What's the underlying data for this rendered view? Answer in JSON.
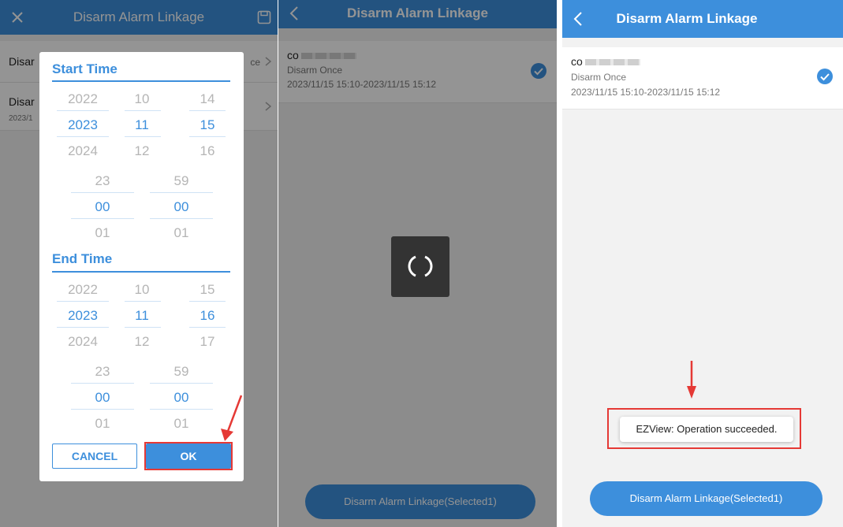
{
  "panel1": {
    "title": "Disarm Alarm Linkage",
    "rows": [
      {
        "t1": "Disar",
        "t1_right": "ce",
        "t2": ""
      },
      {
        "t1": "Disar",
        "t2": "2023/1"
      }
    ],
    "dialog": {
      "start_title": "Start Time",
      "end_title": "End Time",
      "start_date": {
        "years": [
          "2022",
          "2023",
          "2024"
        ],
        "months": [
          "10",
          "11",
          "12"
        ],
        "days": [
          "14",
          "15",
          "16"
        ]
      },
      "start_time": {
        "hours": [
          "23",
          "00",
          "01"
        ],
        "minutes": [
          "59",
          "00",
          "01"
        ]
      },
      "end_date": {
        "years": [
          "2022",
          "2023",
          "2024"
        ],
        "months": [
          "10",
          "11",
          "12"
        ],
        "days": [
          "15",
          "16",
          "17"
        ]
      },
      "end_time": {
        "hours": [
          "23",
          "00",
          "01"
        ],
        "minutes": [
          "59",
          "00",
          "01"
        ]
      },
      "cancel_label": "CANCEL",
      "ok_label": "OK"
    }
  },
  "panel2": {
    "title": "Disarm Alarm Linkage",
    "item": {
      "name_prefix": "co",
      "mode": "Disarm Once",
      "range": "2023/11/15 15:10-2023/11/15 15:12"
    },
    "button_label": "Disarm Alarm Linkage(Selected1)"
  },
  "panel3": {
    "title": "Disarm Alarm Linkage",
    "item": {
      "name_prefix": "co",
      "mode": "Disarm Once",
      "range": "2023/11/15 15:10-2023/11/15 15:12"
    },
    "toast": "EZView: Operation succeeded.",
    "button_label": "Disarm Alarm Linkage(Selected1)"
  },
  "colors": {
    "accent": "#3d8fdc",
    "highlight": "#e53935"
  }
}
